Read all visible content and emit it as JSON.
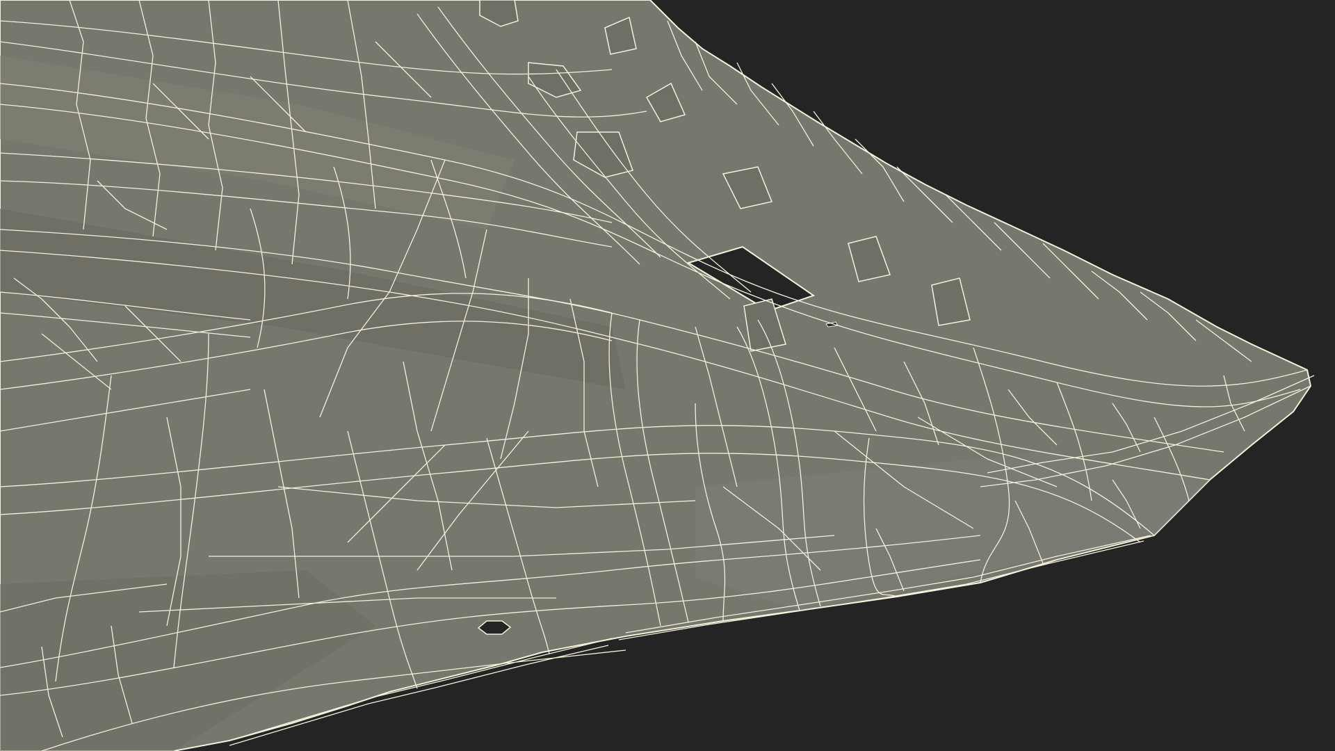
{
  "colors": {
    "background": "#242424",
    "surface": "#76776d",
    "surface_dark": "#65665c",
    "surface_light": "#84857a",
    "wire": "#f4f1dc",
    "hole": "#242424"
  },
  "icons": []
}
